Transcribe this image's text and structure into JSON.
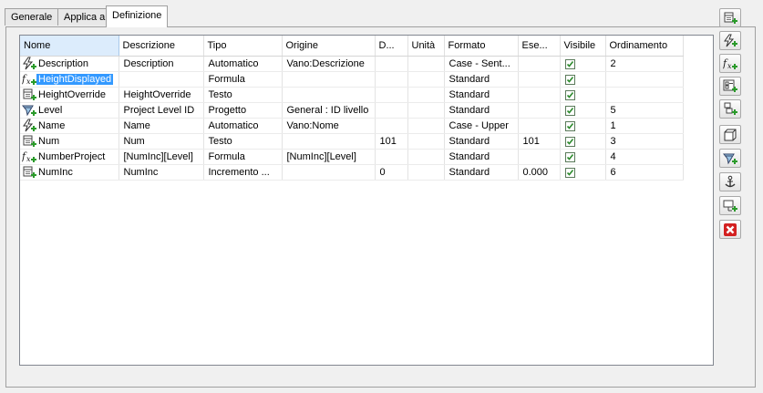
{
  "tabs": [
    {
      "label": "Generale",
      "active": false
    },
    {
      "label": "Applica a",
      "active": false
    },
    {
      "label": "Definizione",
      "active": true
    }
  ],
  "columns": [
    "Nome",
    "Descrizione",
    "Tipo",
    "Origine",
    "D...",
    "Unità",
    "Formato",
    "Ese...",
    "Visibile",
    "Ordinamento"
  ],
  "rows": [
    {
      "icon": "automatic-property-icon",
      "name": "Description",
      "descrizione": "Description",
      "tipo": "Automatico",
      "origine": "Vano:Descrizione",
      "d": "",
      "unita": "",
      "formato": "Case - Sent...",
      "ese": "",
      "visibile": true,
      "ordinamento": "2",
      "selected": false
    },
    {
      "icon": "formula-property-icon",
      "name": "HeightDisplayed",
      "descrizione": "",
      "tipo": "Formula",
      "origine": "",
      "d": "",
      "unita": "",
      "formato": "Standard",
      "ese": "",
      "visibile": true,
      "ordinamento": "",
      "selected": true
    },
    {
      "icon": "text-property-icon",
      "name": "HeightOverride",
      "descrizione": "HeightOverride",
      "tipo": "Testo",
      "origine": "",
      "d": "",
      "unita": "",
      "formato": "Standard",
      "ese": "",
      "visibile": true,
      "ordinamento": "",
      "selected": false
    },
    {
      "icon": "project-property-icon",
      "name": "Level",
      "descrizione": "Project Level ID",
      "tipo": "Progetto",
      "origine": "General : ID livello",
      "d": "",
      "unita": "",
      "formato": "Standard",
      "ese": "",
      "visibile": true,
      "ordinamento": "5",
      "selected": false
    },
    {
      "icon": "automatic-property-icon",
      "name": "Name",
      "descrizione": "Name",
      "tipo": "Automatico",
      "origine": "Vano:Nome",
      "d": "",
      "unita": "",
      "formato": "Case - Upper",
      "ese": "",
      "visibile": true,
      "ordinamento": "1",
      "selected": false
    },
    {
      "icon": "text-property-icon",
      "name": "Num",
      "descrizione": "Num",
      "tipo": "Testo",
      "origine": "",
      "d": "101",
      "unita": "",
      "formato": "Standard",
      "ese": "101",
      "visibile": true,
      "ordinamento": "3",
      "selected": false
    },
    {
      "icon": "formula-property-icon",
      "name": "NumberProject",
      "descrizione": "[NumInc][Level]",
      "tipo": "Formula",
      "origine": "[NumInc][Level]",
      "d": "",
      "unita": "",
      "formato": "Standard",
      "ese": "",
      "visibile": true,
      "ordinamento": "4",
      "selected": false
    },
    {
      "icon": "text-property-icon",
      "name": "NumInc",
      "descrizione": "NumInc",
      "tipo": "Incremento ...",
      "origine": "",
      "d": "0",
      "unita": "",
      "formato": "Standard",
      "ese": "0.000",
      "visibile": true,
      "ordinamento": "6",
      "selected": false
    }
  ],
  "toolbar": [
    {
      "name": "add-text-property-button",
      "icon": "text-property-icon"
    },
    {
      "name": "add-automatic-property-button",
      "icon": "automatic-property-icon"
    },
    {
      "name": "add-formula-property-button",
      "icon": "formula-property-icon"
    },
    {
      "name": "add-classification-property-button",
      "icon": "classification-property-icon"
    },
    {
      "name": "add-increment-property-button",
      "icon": "increment-property-icon"
    },
    {
      "name": "add-graphic-property-button",
      "icon": "graphic-property-icon"
    },
    {
      "name": "add-project-property-button",
      "icon": "project-property-icon"
    },
    {
      "name": "add-anchor-property-button",
      "icon": "anchor-property-icon"
    },
    {
      "name": "add-reference-property-button",
      "icon": "reference-property-icon"
    },
    {
      "name": "delete-property-button",
      "icon": "delete-icon"
    }
  ],
  "colors": {
    "selection": "#3399ff",
    "sorted_header": "#dcecfc",
    "check": "#2e8b2e",
    "delete": "#d32020"
  }
}
